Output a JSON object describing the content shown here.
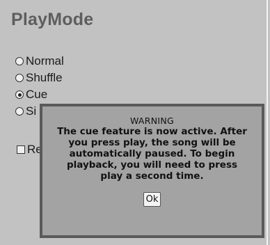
{
  "header": {
    "title": "PlayMode"
  },
  "play_mode": {
    "options": [
      {
        "label": "Normal",
        "checked": false
      },
      {
        "label": "Shuffle",
        "checked": false
      },
      {
        "label": "Cue",
        "checked": true
      },
      {
        "label": "Si",
        "checked": false
      }
    ]
  },
  "checkbox": {
    "label": "Re",
    "checked": false
  },
  "dialog": {
    "title": "WARNING",
    "lines": [
      "The cue feature is now active. After",
      "you press play, the song will be",
      "automatically paused. To begin",
      "playback, you will need to press",
      "play a second time."
    ],
    "ok_label": "Ok"
  }
}
